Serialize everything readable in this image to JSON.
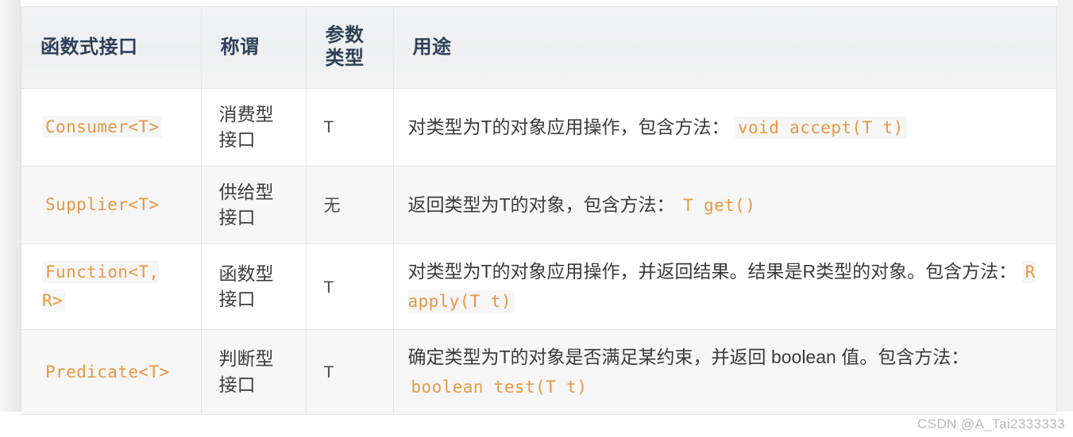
{
  "table": {
    "headers": [
      {
        "lines": [
          "函数式接口"
        ]
      },
      {
        "lines": [
          "称谓"
        ]
      },
      {
        "lines": [
          "参数",
          "类型"
        ]
      },
      {
        "lines": [
          "用途"
        ]
      }
    ],
    "rows": [
      {
        "interface": "Consumer<T>",
        "name_lines": [
          "消费型",
          "接口"
        ],
        "param_type": "T",
        "usage_prefix": "对类型为T的对象应用操作，包含方法：",
        "usage_code": "void accept(T t)",
        "usage_suffix": ""
      },
      {
        "interface": "Supplier<T>",
        "name_lines": [
          "供给型",
          "接口"
        ],
        "param_type": "无",
        "usage_prefix": "返回类型为T的对象，包含方法：",
        "usage_code": "T get()",
        "usage_suffix": ""
      },
      {
        "interface": "Function<T, R>",
        "name_lines": [
          "函数型",
          "接口"
        ],
        "param_type": "T",
        "usage_prefix": "对类型为T的对象应用操作，并返回结果。结果是R类型的对象。包含方法：",
        "usage_code": "R apply(T t)",
        "usage_suffix": ""
      },
      {
        "interface": "Predicate<T>",
        "name_lines": [
          "判断型",
          "接口"
        ],
        "param_type": "T",
        "usage_prefix": "确定类型为T的对象是否满足某约束，并返回 boolean 值。包含方法：",
        "usage_code": "boolean test(T t)",
        "usage_suffix": ""
      }
    ]
  },
  "watermark": "CSDN @A_Tai2333333",
  "colors": {
    "code_text": "#e8983f",
    "code_background": "#f6f6f7",
    "header_text": "#2f4159",
    "body_text": "#3b3b3b",
    "stripe_background": "#f7f7f7",
    "border": "#e6e6e6"
  }
}
